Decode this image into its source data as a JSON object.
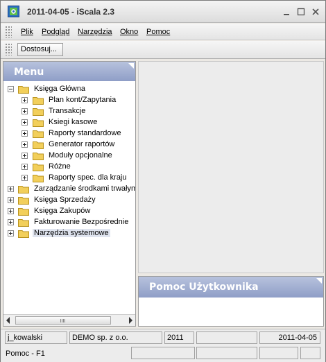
{
  "window": {
    "title": "2011-04-05 - iScala 2.3"
  },
  "menubar": {
    "items": [
      {
        "label": "Plik"
      },
      {
        "label": "Podgląd"
      },
      {
        "label": "Narzędzia"
      },
      {
        "label": "Okno"
      },
      {
        "label": "Pomoc"
      }
    ]
  },
  "toolbar": {
    "customize_label": "Dostosuj..."
  },
  "menu_panel": {
    "title": "Menu",
    "tree": [
      {
        "label": "Księga Główna",
        "expanded": true
      },
      {
        "label": "Plan kont/Zapytania"
      },
      {
        "label": "Transakcje"
      },
      {
        "label": "Ksiegi kasowe"
      },
      {
        "label": "Raporty standardowe"
      },
      {
        "label": "Generator raportów"
      },
      {
        "label": "Moduły opcjonalne"
      },
      {
        "label": "Różne"
      },
      {
        "label": "Raporty spec. dla kraju"
      },
      {
        "label": "Zarządzanie środkami trwałymi"
      },
      {
        "label": "Księga Sprzedaży"
      },
      {
        "label": "Księga Zakupów"
      },
      {
        "label": "Fakturowanie Bezpośrednie"
      },
      {
        "label": "Narzędzia systemowe",
        "selected": true
      }
    ]
  },
  "help_panel": {
    "title": "Pomoc Użytkownika"
  },
  "statusbar": {
    "user": "j_kowalski",
    "company": "DEMO sp. z o.o.",
    "year": "2011",
    "date": "2011-04-05",
    "help_hint": "Pomoc - F1"
  },
  "colors": {
    "panel_header": "#8f9ec7",
    "folder": "#f2cf5b",
    "selection": "#dfe4ef"
  }
}
